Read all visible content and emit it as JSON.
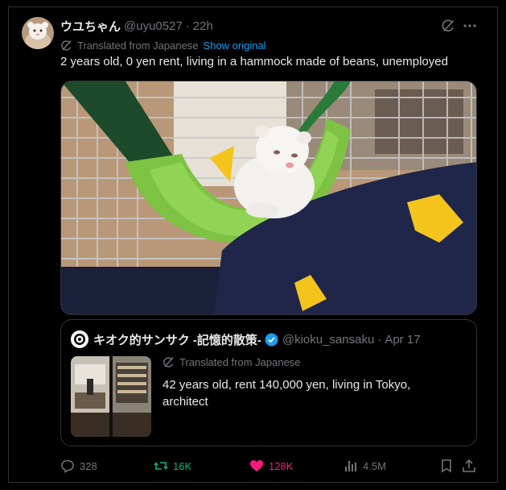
{
  "tweet": {
    "display_name": "ウユちゃん",
    "handle": "@uyu0527",
    "time": "22h",
    "translated_label": "Translated from Japanese",
    "show_original_label": "Show original",
    "text": "2 years old, 0 yen rent, living in a hammock made of beans, unemployed"
  },
  "quote": {
    "display_name": "キオク的サンサク -記憶的散策-",
    "handle": "@kioku_sansaku",
    "date": "Apr 17",
    "translated_label": "Translated from Japanese",
    "text": "42 years old, rent 140,000 yen, living in Tokyo, architect"
  },
  "actions": {
    "reply_count": "328",
    "repost_count": "16K",
    "like_count": "128K",
    "views_count": "4.5M"
  },
  "colors": {
    "accent": "#1d9bf0",
    "repost": "#00ba7c",
    "like": "#f91880",
    "muted": "#71767b"
  },
  "icons": [
    "grok-icon",
    "more-icon",
    "translate-icon",
    "verified-icon",
    "reply-icon",
    "repost-icon",
    "like-icon",
    "views-icon",
    "bookmark-icon",
    "share-icon"
  ]
}
